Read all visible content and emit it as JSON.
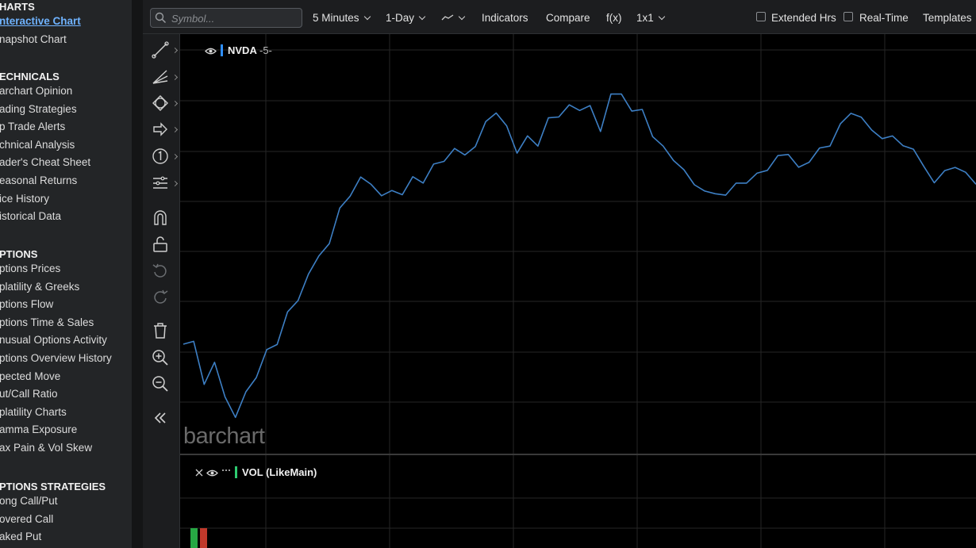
{
  "nav": {
    "sections": [
      {
        "title": "CHARTS",
        "items": [
          "Interactive Chart",
          "Snapshot Chart"
        ],
        "active": 0
      },
      {
        "title": "TECHNICALS",
        "items": [
          "Barchart Opinion",
          "Trading Strategies",
          "Top Trade Alerts",
          "Technical Analysis",
          "Trader's Cheat Sheet",
          "Seasonal Returns",
          "Price History",
          "Historical Data"
        ]
      },
      {
        "title": "OPTIONS",
        "items": [
          "Options Prices",
          "Volatility & Greeks",
          "Options Flow",
          "Options Time & Sales",
          "Unusual Options Activity",
          "Options Overview History",
          "Expected Move",
          "Put/Call Ratio",
          "Volatility Charts",
          "Gamma Exposure",
          "Max Pain & Vol Skew"
        ]
      },
      {
        "title": "OPTIONS STRATEGIES",
        "items": [
          "Long Call/Put",
          "Covered Call",
          "Naked Put"
        ]
      }
    ],
    "display": {
      "CHARTS": "HARTS",
      "Interactive Chart": "nteractive Chart",
      "Snapshot Chart": "napshot Chart",
      "TECHNICALS": "ECHNICALS",
      "Barchart Opinion": "archart Opinion",
      "Trading Strategies": "ading Strategies",
      "Top Trade Alerts": "p Trade Alerts",
      "Technical Analysis": "chnical Analysis",
      "Trader's Cheat Sheet": "ader's Cheat Sheet",
      "Seasonal Returns": "easonal Returns",
      "Price History": "ice History",
      "Historical Data": "istorical Data",
      "OPTIONS": "PTIONS",
      "Options Prices": "ptions Prices",
      "Volatility & Greeks": "platility & Greeks",
      "Options Flow": "ptions Flow",
      "Options Time & Sales": "ptions Time & Sales",
      "Unusual Options Activity": "nusual Options Activity",
      "Options Overview History": "ptions Overview History",
      "Expected Move": "pected Move",
      "Put/Call Ratio": "ut/Call Ratio",
      "Volatility Charts": "platility Charts",
      "Gamma Exposure": "amma Exposure",
      "Max Pain & Vol Skew": "ax Pain & Vol Skew",
      "OPTIONS STRATEGIES": "PTIONS STRATEGIES",
      "Long Call/Put": "ong Call/Put",
      "Covered Call": "overed Call",
      "Naked Put": "aked Put"
    }
  },
  "toolbar": {
    "search_placeholder": "Symbol...",
    "interval": "5 Minutes",
    "range": "1-Day",
    "indicators": "Indicators",
    "compare": "Compare",
    "fx": "f(x)",
    "layout": "1x1",
    "extended_hrs": "Extended Hrs",
    "real_time": "Real-Time",
    "templates": "Templates"
  },
  "tools": [
    {
      "icon": "trendline-icon",
      "has_sub": true
    },
    {
      "icon": "fibonacci-icon",
      "has_sub": true
    },
    {
      "icon": "shape-icon",
      "has_sub": true
    },
    {
      "icon": "arrow-icon",
      "has_sub": true
    },
    {
      "icon": "number-marker-icon",
      "has_sub": true
    },
    {
      "icon": "lines-icon",
      "has_sub": true
    },
    {
      "icon": "magnet-icon",
      "has_sub": false
    },
    {
      "icon": "unlock-icon",
      "has_sub": false
    },
    {
      "icon": "undo-icon",
      "has_sub": false
    },
    {
      "icon": "redo-icon",
      "has_sub": false
    },
    {
      "icon": "trash-icon",
      "has_sub": false
    },
    {
      "icon": "zoom-in-icon",
      "has_sub": false
    },
    {
      "icon": "zoom-out-icon",
      "has_sub": false
    },
    {
      "icon": "collapse-icon",
      "has_sub": false
    }
  ],
  "chart": {
    "symbol": "NVDA",
    "symbol_suffix": "-5-",
    "volume_label": "VOL (LikeMain)",
    "watermark": "barchart",
    "line_color": "#3d7fc4",
    "vol_up_color": "#27a844",
    "vol_down_color": "#c0392b"
  },
  "chart_data": {
    "type": "line",
    "series": [
      {
        "values": [
          0.255,
          0.226,
          0.662,
          0.438,
          0.789,
          0.996,
          0.737,
          0.593,
          0.309,
          0.258,
          -0.072,
          -0.187,
          -0.455,
          -0.64,
          -0.764,
          -1.125,
          -1.245,
          -1.439,
          -1.365,
          -1.249,
          -1.302,
          -1.26,
          -1.442,
          -1.378,
          -1.57,
          -1.597,
          -1.728,
          -1.662,
          -1.748,
          -2.001,
          -2.087,
          -1.958,
          -1.681,
          -1.856,
          -1.752,
          -2.038,
          -2.047,
          -2.17,
          -2.113,
          -2.163,
          -1.9,
          -2.279,
          -2.279,
          -2.106,
          -2.123,
          -1.848,
          -1.752,
          -1.606,
          -1.513,
          -1.36,
          -1.297,
          -1.269,
          -1.255,
          -1.377,
          -1.377,
          -1.477,
          -1.506,
          -1.656,
          -1.667,
          -1.538,
          -1.588,
          -1.733,
          -1.752,
          -1.978,
          -2.084,
          -2.045,
          -1.914,
          -1.828,
          -1.855,
          -1.756,
          -1.721,
          -1.546,
          -1.38,
          -1.504,
          -1.536,
          -1.487,
          -1.366
        ]
      }
    ],
    "volume": {
      "values": [
        1,
        1
      ],
      "colors": [
        "up",
        "down"
      ]
    },
    "grid": true
  }
}
